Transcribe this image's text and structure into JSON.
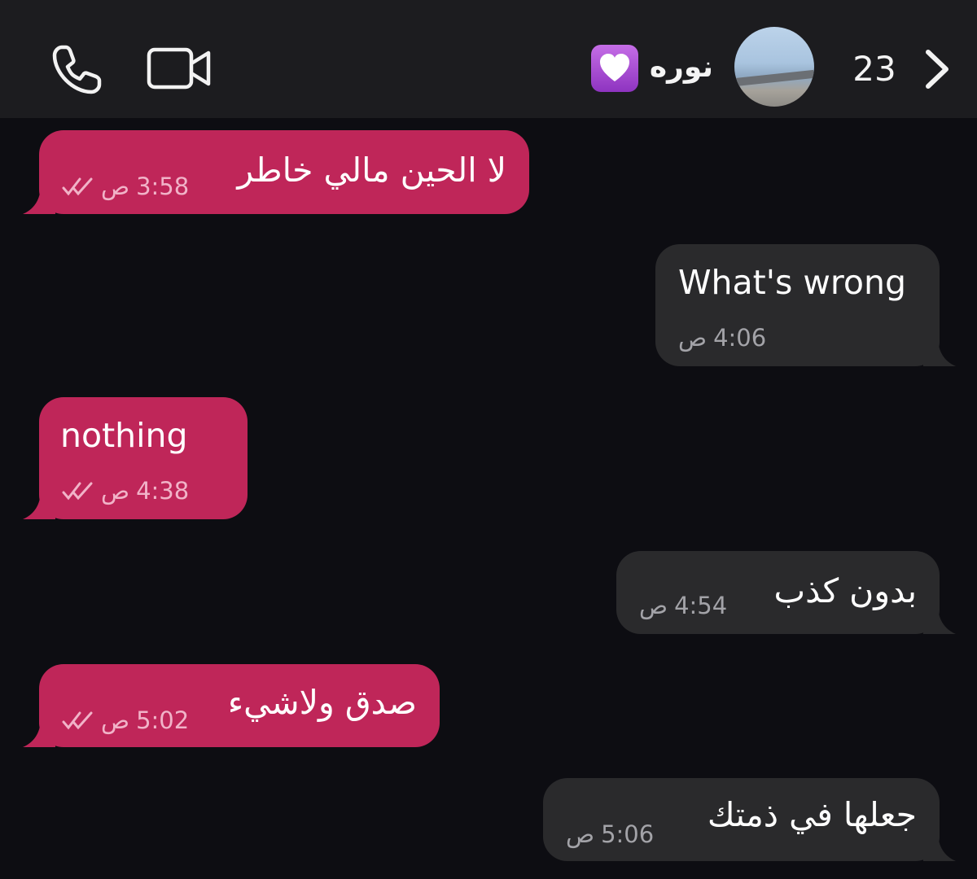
{
  "header": {
    "unread_count": "23",
    "contact_name": "نوره",
    "heart_emoji": "purple-heart",
    "call_icon": "phone-icon",
    "video_icon": "video-camera-icon",
    "back_icon": "chevron-right-icon"
  },
  "colors": {
    "background": "#0d0d12",
    "header": "#1c1c1f",
    "incoming_bubble": "#bf2659",
    "outgoing_bubble": "#2a2a2c"
  },
  "messages": [
    {
      "direction": "incoming",
      "text": "لا الحين مالي خاطر",
      "time": "3:58",
      "ampm": "ص",
      "read": true
    },
    {
      "direction": "outgoing",
      "text": "What's wrong",
      "time": "4:06",
      "ampm": "ص"
    },
    {
      "direction": "incoming",
      "text": "nothing",
      "time": "4:38",
      "ampm": "ص",
      "read": true
    },
    {
      "direction": "outgoing",
      "text": "بدون كذب",
      "time": "4:54",
      "ampm": "ص"
    },
    {
      "direction": "incoming",
      "text": "صدق ولاشيء",
      "time": "5:02",
      "ampm": "ص",
      "read": true
    },
    {
      "direction": "outgoing",
      "text": "جعلها في ذمتك",
      "time": "5:06",
      "ampm": "ص"
    }
  ]
}
